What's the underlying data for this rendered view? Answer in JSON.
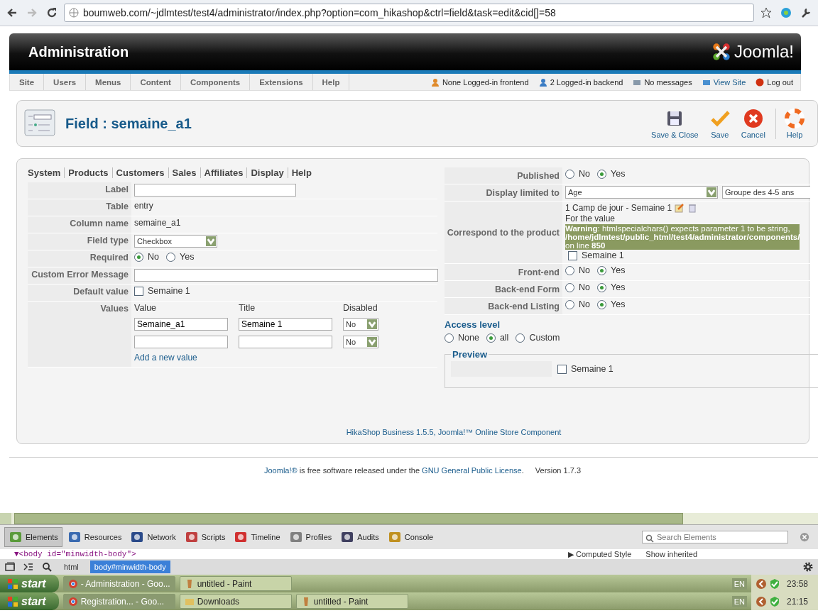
{
  "browser": {
    "url": "boumweb.com/~jdlmtest/test4/administrator/index.php?option=com_hikashop&ctrl=field&task=edit&cid[]=58"
  },
  "header": {
    "title": "Administration",
    "logo": "Joomla!"
  },
  "menu": [
    "Site",
    "Users",
    "Menus",
    "Content",
    "Components",
    "Extensions",
    "Help"
  ],
  "status": [
    {
      "kind": "frontend",
      "label": "None Logged-in frontend"
    },
    {
      "kind": "backend",
      "label": "2 Logged-in backend"
    },
    {
      "kind": "messages",
      "label": "No messages"
    },
    {
      "kind": "view-site",
      "label": "View Site"
    },
    {
      "kind": "logout",
      "label": "Log out"
    }
  ],
  "toolbar": {
    "title": "Field : semaine_a1",
    "buttons": [
      {
        "kind": "save-close",
        "label": "Save & Close"
      },
      {
        "kind": "save",
        "label": "Save"
      },
      {
        "kind": "cancel",
        "label": "Cancel"
      },
      {
        "kind": "help",
        "label": "Help"
      }
    ]
  },
  "tabs": [
    "System",
    "Products",
    "Customers",
    "Sales",
    "Affiliates",
    "Display",
    "Help"
  ],
  "left_form": [
    {
      "kind": "input",
      "label": "Label"
    },
    {
      "kind": "text",
      "label": "Table",
      "value": "entry"
    },
    {
      "kind": "text",
      "label": "Column name",
      "value": "semaine_a1"
    },
    {
      "kind": "select",
      "label": "Field type",
      "value": "Checkbox"
    },
    {
      "kind": "radio",
      "label": "Required",
      "options": [
        {
          "label": "No",
          "selected": true
        },
        {
          "label": "Yes",
          "selected": false
        }
      ]
    },
    {
      "kind": "long-input",
      "label": "Custom Error Message"
    },
    {
      "kind": "checkbox",
      "label": "Default value",
      "option": {
        "label": "Semaine 1",
        "checked": false
      }
    },
    {
      "kind": "values",
      "label": "Values",
      "columns": [
        "Value",
        "Title",
        "Disabled"
      ],
      "rows": [
        {
          "value": "Semaine_a1",
          "title": "Semaine 1",
          "disabled": "No"
        },
        {
          "disabled": "No"
        }
      ],
      "link": "Add a new value"
    }
  ],
  "right_form": [
    {
      "kind": "radio",
      "label": "Published",
      "options": [
        {
          "label": "No",
          "selected": false
        },
        {
          "label": "Yes",
          "selected": true
        }
      ]
    },
    {
      "kind": "select-pair",
      "label": "Display limited to",
      "value": "Age",
      "second": "Groupe des 4-5 ans"
    },
    {
      "kind": "product",
      "label": "Correspond to the product",
      "product": "1 Camp de jour - Semaine 1",
      "note": "For the value",
      "warning": [
        "**Warning**: htmlspecialchars() expects parameter 1 to be string,",
        "**/home/jdlmtest/public_html/test4/administrator/components/**",
        "on line **850**"
      ],
      "option": {
        "label": "Semaine 1",
        "checked": false
      }
    },
    {
      "kind": "radio",
      "label": "Front-end",
      "options": [
        {
          "label": "No",
          "selected": false
        },
        {
          "label": "Yes",
          "selected": true
        }
      ]
    },
    {
      "kind": "radio",
      "label": "Back-end Form",
      "options": [
        {
          "label": "No",
          "selected": false
        },
        {
          "label": "Yes",
          "selected": true
        }
      ]
    },
    {
      "kind": "radio",
      "label": "Back-end Listing",
      "options": [
        {
          "label": "No",
          "selected": false
        },
        {
          "label": "Yes",
          "selected": true
        }
      ]
    }
  ],
  "access": {
    "title": "Access level",
    "options": [
      {
        "label": "None",
        "selected": false
      },
      {
        "label": "all",
        "selected": true
      },
      {
        "label": "Custom",
        "selected": false
      }
    ]
  },
  "preview": {
    "title": "Preview",
    "option": {
      "label": "Semaine 1",
      "checked": false
    }
  },
  "component_footer": "HikaShop Business 1.5.5, Joomla!™ Online Store Component",
  "page_footer": {
    "link1": "Joomla!®",
    "text": " is free software released under the ",
    "link2": "GNU General Public License",
    "end": ".",
    "version": "Version 1.7.3"
  },
  "devtools": {
    "tabs": [
      {
        "kind": "elements",
        "label": "Elements",
        "selected": true
      },
      {
        "kind": "resources",
        "label": "Resources",
        "selected": false
      },
      {
        "kind": "network",
        "label": "Network",
        "selected": false
      },
      {
        "kind": "scripts",
        "label": "Scripts",
        "selected": false
      },
      {
        "kind": "timeline",
        "label": "Timeline",
        "selected": false
      },
      {
        "kind": "profiles",
        "label": "Profiles",
        "selected": false
      },
      {
        "kind": "audits",
        "label": "Audits",
        "selected": false
      },
      {
        "kind": "console",
        "label": "Console",
        "selected": false
      }
    ],
    "search_placeholder": "Search Elements",
    "code": "▼<body id=\"minwidth-body\">",
    "side": "▶ Computed Style",
    "inherited": "Show inherited",
    "crumbs": [
      {
        "label": "html",
        "selected": false
      },
      {
        "label": "body#minwidth-body",
        "selected": true
      }
    ]
  },
  "taskbars": [
    {
      "start": "start",
      "tasks": [
        {
          "kind": "chrome",
          "label": "- Administration - Goo...",
          "selected": true
        },
        {
          "kind": "paint",
          "label": "untitled - Paint",
          "selected": false
        }
      ],
      "lang": "EN",
      "time": "23:58"
    },
    {
      "start": "start",
      "tasks": [
        {
          "kind": "chrome",
          "label": "Registration... - Goo...",
          "selected": true
        },
        {
          "kind": "folder",
          "label": "Downloads",
          "selected": false
        },
        {
          "kind": "paint",
          "label": "untitled - Paint",
          "selected": false
        }
      ],
      "lang": "EN",
      "time": "21:15"
    }
  ]
}
